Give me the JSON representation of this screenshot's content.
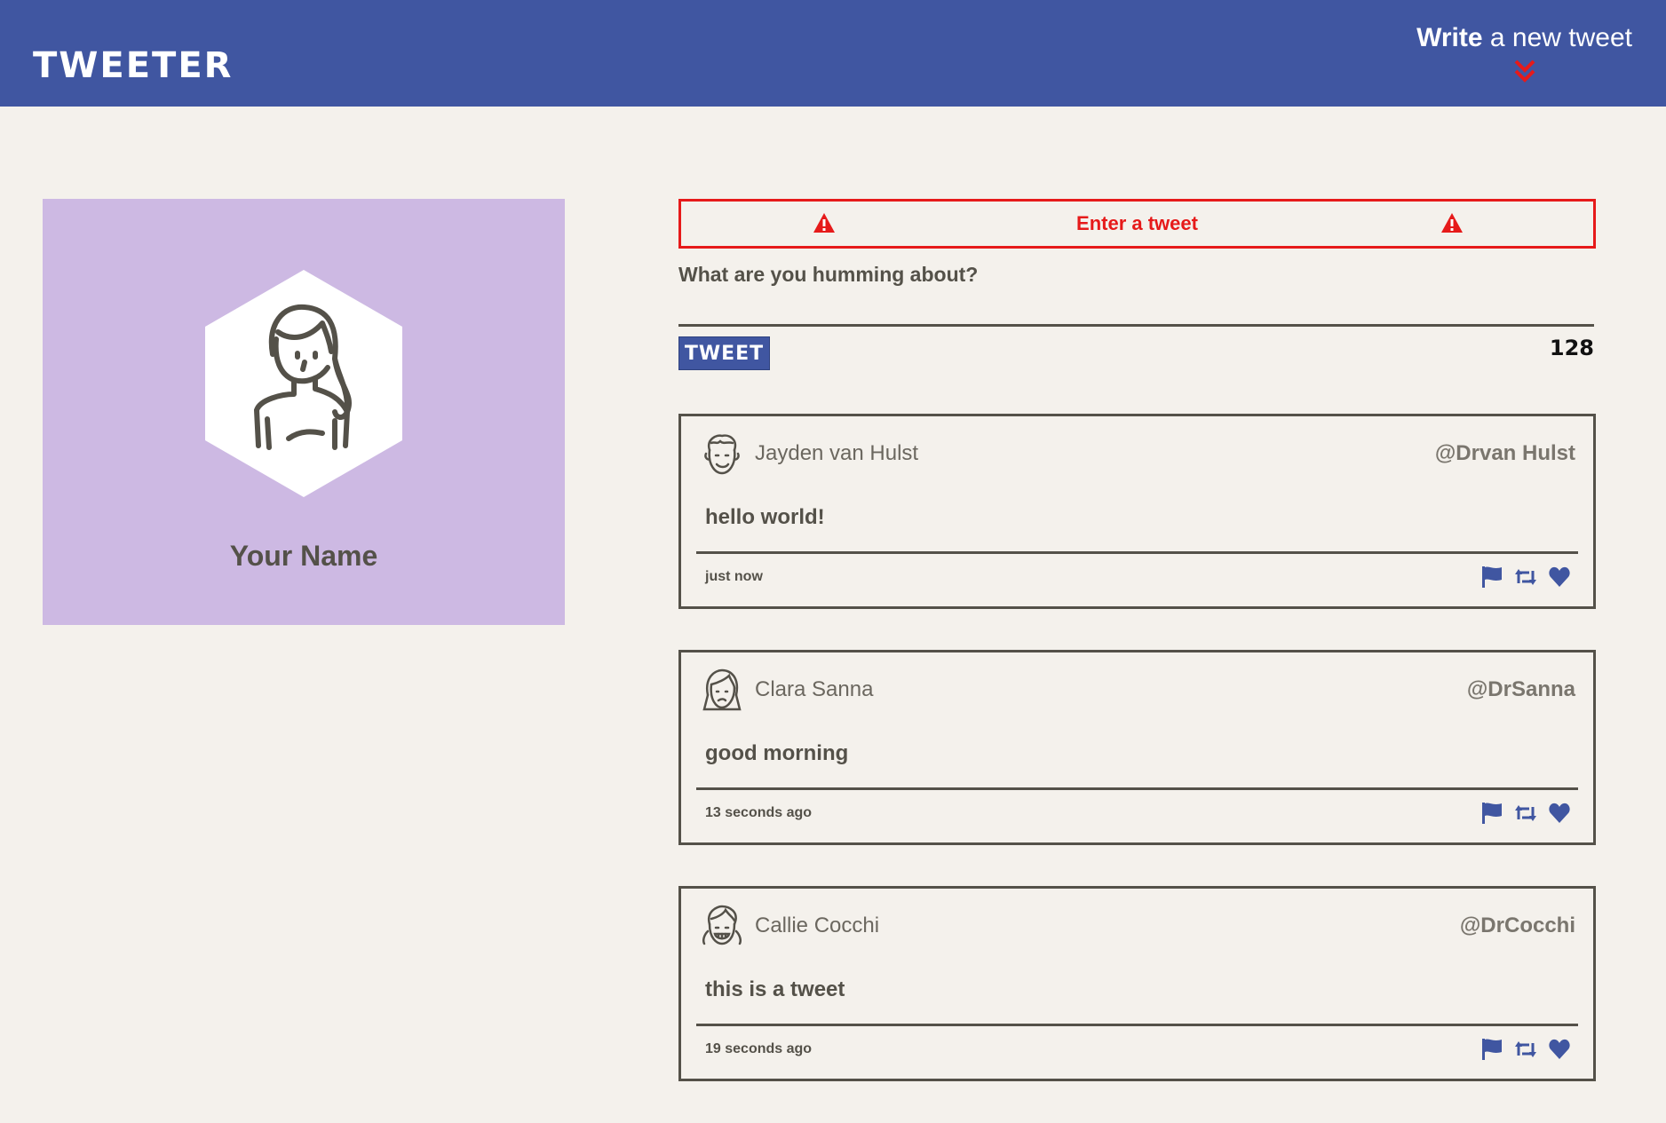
{
  "nav": {
    "brand": "TWEETER",
    "write_strong": "Write",
    "write_rest": " a new tweet"
  },
  "profile": {
    "name": "Your Name"
  },
  "compose": {
    "error": "Enter a tweet",
    "question": "What are you humming about?",
    "button_label": "TWEET",
    "counter": "128"
  },
  "tweets": [
    {
      "name": "Jayden van Hulst",
      "handle": "@Drvan Hulst",
      "body": "hello world!",
      "time": "just now"
    },
    {
      "name": "Clara Sanna",
      "handle": "@DrSanna",
      "body": "good morning",
      "time": "13 seconds ago"
    },
    {
      "name": "Callie Cocchi",
      "handle": "@DrCocchi",
      "body": "this is a tweet",
      "time": "19 seconds ago"
    }
  ],
  "colors": {
    "nav": "#4056a1",
    "background": "#f4f1ec",
    "profile_card": "#cdb9e3",
    "error": "#e61a1a",
    "text": "#545149"
  },
  "icons": {
    "write_arrow": "double-chevron-down-icon",
    "warning": "warning-triangle-icon",
    "flag": "flag-icon",
    "retweet": "retweet-icon",
    "like": "heart-icon"
  }
}
